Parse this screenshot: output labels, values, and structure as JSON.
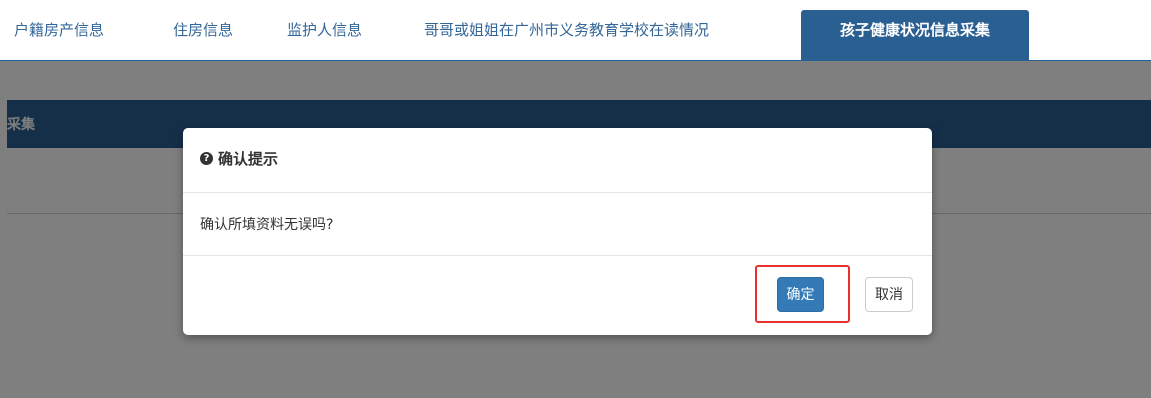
{
  "tabs": [
    {
      "label": "户籍房产信息",
      "active": false
    },
    {
      "label": "住房信息",
      "active": false
    },
    {
      "label": "监护人信息",
      "active": false
    },
    {
      "label": "哥哥或姐姐在广州市义务教育学校在读情况",
      "active": false
    },
    {
      "label": "孩子健康状况信息采集",
      "active": true
    }
  ],
  "panel": {
    "header_text": "采集"
  },
  "modal": {
    "title_icon": "question-circle-icon",
    "title": "确认提示",
    "message": "确认所填资料无误吗?",
    "ok_label": "确定",
    "cancel_label": "取消"
  },
  "colors": {
    "brand": "#2a5f92",
    "primary_button": "#337ab7",
    "highlight": "#e8312f"
  }
}
